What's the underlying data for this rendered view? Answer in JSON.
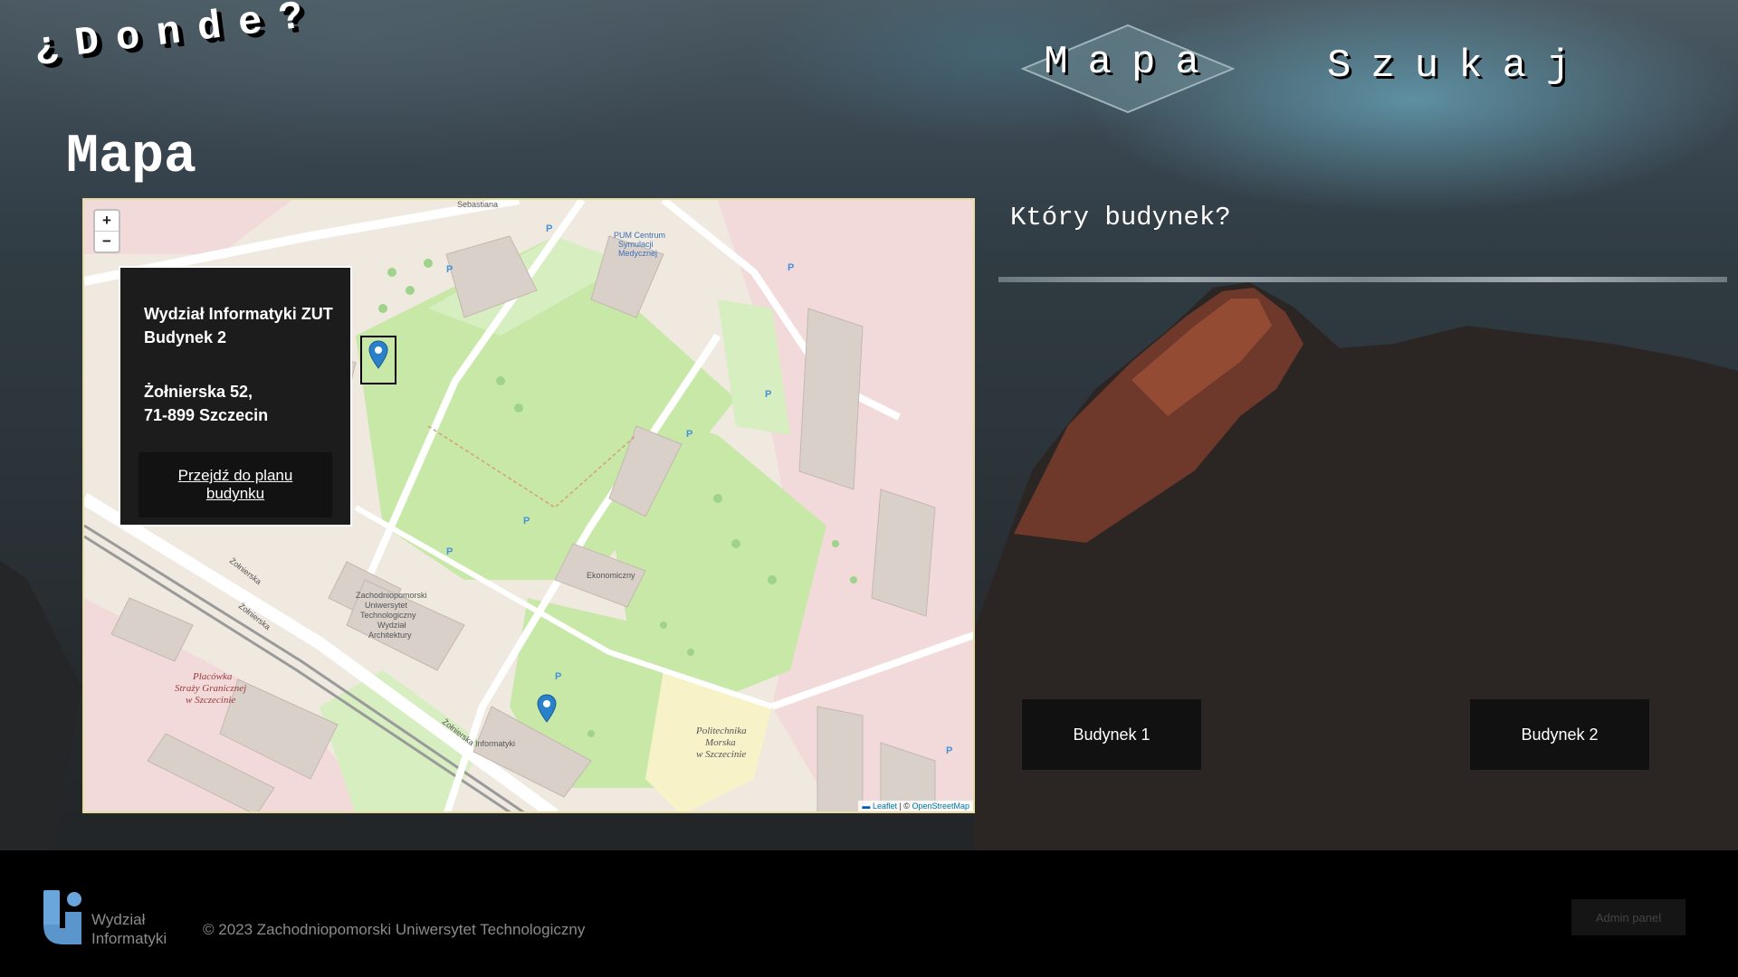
{
  "header": {
    "logo": "¿Donde?",
    "nav": [
      {
        "label": "Mapa",
        "active": true
      },
      {
        "label": "Szukaj",
        "active": false
      }
    ]
  },
  "main": {
    "title": "Mapa",
    "map": {
      "zoom_in": "+",
      "zoom_out": "−",
      "attribution_leaflet": "Leaflet",
      "attribution_sep": " | © ",
      "attribution_osm": "OpenStreetMap",
      "popup": {
        "line1": "Wydział Informatyki ZUT",
        "line2": "Budynek 2",
        "line3": "Żołnierska 52,",
        "line4": "71-899 Szczecin",
        "button": "Przejdź do planu budynku"
      },
      "labels": {
        "street1": "Sebastiana",
        "street2": "Żołnierska",
        "street3": "Żołnierska",
        "street4": "Żołnierska",
        "place1": "Placówka",
        "place2": "Straży Granicznej",
        "place3": "w Szczecinie",
        "campus1": "Politechnika",
        "campus2": "Morska",
        "campus3": "w Szczecinie",
        "bldg1": "Zachodniopomorski",
        "bldg2": "Uniwersytet",
        "bldg3": "Technologiczny",
        "bldg4": "Wydział",
        "bldg5": "Informatyki",
        "arch": "Architektury",
        "eco": "Ekonomiczny",
        "pum1": "PUM Centrum",
        "pum2": "Symulacji",
        "pum3": "Medycznej",
        "parking": "P"
      }
    },
    "right_title": "Który budynek?",
    "buttons": [
      "Budynek 1",
      "Budynek 2"
    ]
  },
  "footer": {
    "logo_line1": "Wydział",
    "logo_line2": "Informatyki",
    "copyright": "© 2023 Zachodniopomorski Uniwersytet Technologiczny",
    "admin": "Admin panel"
  },
  "colors": {
    "accent_marker": "#2a81cb",
    "map_park": "#c8e8a8",
    "map_residential": "#f2dada",
    "logo_blue": "#6aa6dc"
  },
  "icons": [
    "map-marker-icon",
    "wi-logo-icon"
  ]
}
